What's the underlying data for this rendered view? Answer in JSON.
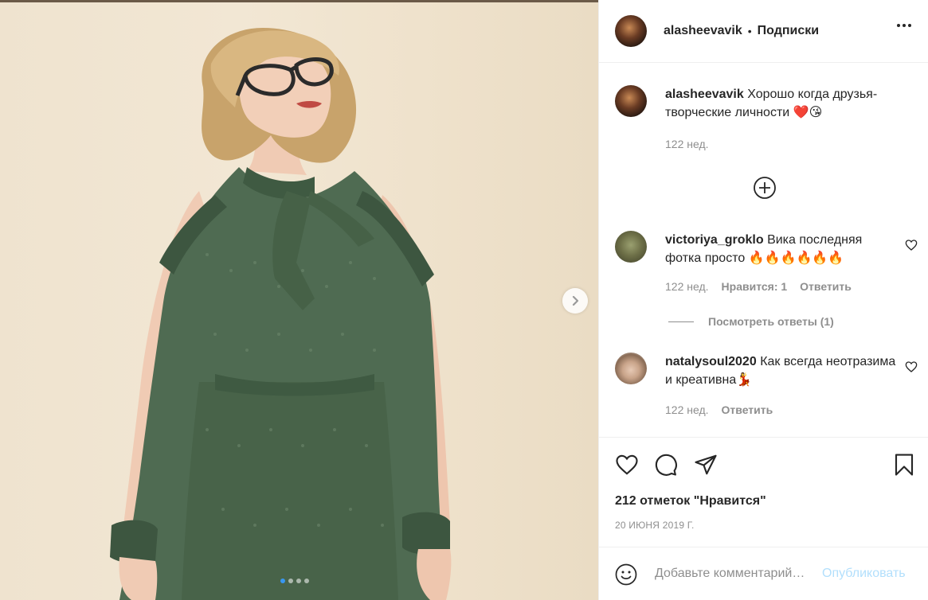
{
  "post": {
    "username": "alasheevavik",
    "separator": "•",
    "follow_label": "Подписки",
    "more_icon": "more-horizontal-icon"
  },
  "caption": {
    "username": "alasheevavik",
    "text": "Хорошо когда друзья-творческие личности ❤️😘",
    "time": "122 нед."
  },
  "comments": [
    {
      "username": "victoriya_groklo",
      "text": "Вика последняя фотка просто 🔥🔥🔥🔥🔥🔥",
      "time": "122 нед.",
      "likes": "Нравится: 1",
      "reply": "Ответить",
      "view_replies": "Посмотреть ответы (1)"
    },
    {
      "username": "natalysoul2020",
      "text": "Как всегда неотразима и креативна💃",
      "time": "122 нед.",
      "reply": "Ответить"
    }
  ],
  "stats": {
    "likes": "212 отметок \"Нравится\"",
    "date": "20 ИЮНЯ 2019 Г."
  },
  "composer": {
    "placeholder": "Добавьте комментарий…",
    "publish_label": "Опубликовать"
  },
  "carousel": {
    "count": 4,
    "active": 1
  },
  "colors": {
    "accent": "#3897f0",
    "publish_disabled": "#b2dffc",
    "text": "#262626",
    "muted": "#8e8e8e",
    "heart_red": "#e0245e"
  }
}
